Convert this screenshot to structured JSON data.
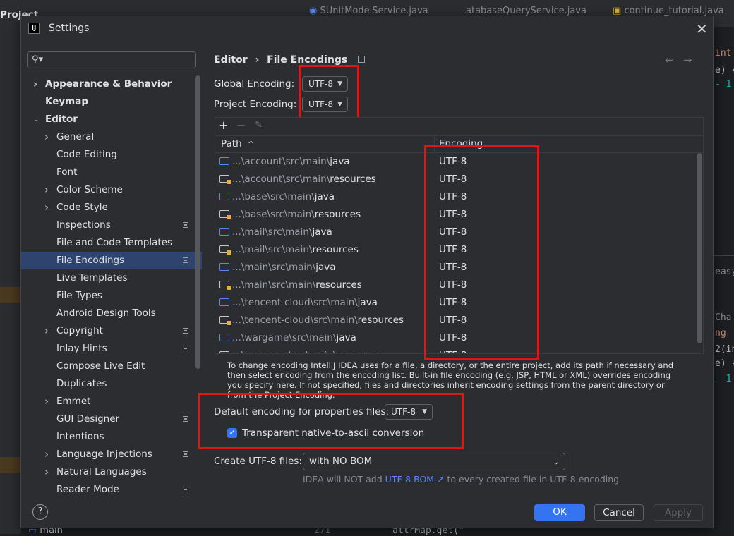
{
  "background": {
    "project_label": "Project",
    "tabs": [
      {
        "label": "SUnitModelService.java"
      },
      {
        "label": "atabaseQueryService.java"
      },
      {
        "label": "continue_tutorial.java"
      }
    ],
    "code_fragments": [
      "int",
      "e) {",
      "- 1",
      "easy",
      "Cha",
      "ng",
      "2(in",
      "e) {",
      "- 1"
    ],
    "bottom_code": "attrMap.get(\"",
    "bottom_line": "271",
    "bottom_node": "main"
  },
  "dialog": {
    "title": "Settings",
    "logo_text": "IJ",
    "search_placeholder": "",
    "tree": [
      {
        "label": "Appearance & Behavior",
        "level": 0,
        "expandable": true,
        "expanded": false,
        "bold": true
      },
      {
        "label": "Keymap",
        "level": 0,
        "expandable": false,
        "bold": true
      },
      {
        "label": "Editor",
        "level": 0,
        "expandable": true,
        "expanded": true,
        "bold": true
      },
      {
        "label": "General",
        "level": 1,
        "expandable": true
      },
      {
        "label": "Code Editing",
        "level": 1
      },
      {
        "label": "Font",
        "level": 1
      },
      {
        "label": "Color Scheme",
        "level": 1,
        "expandable": true
      },
      {
        "label": "Code Style",
        "level": 1,
        "expandable": true
      },
      {
        "label": "Inspections",
        "level": 1,
        "marker": true
      },
      {
        "label": "File and Code Templates",
        "level": 1
      },
      {
        "label": "File Encodings",
        "level": 1,
        "marker": true,
        "selected": true
      },
      {
        "label": "Live Templates",
        "level": 1
      },
      {
        "label": "File Types",
        "level": 1
      },
      {
        "label": "Android Design Tools",
        "level": 1
      },
      {
        "label": "Copyright",
        "level": 1,
        "expandable": true,
        "marker": true
      },
      {
        "label": "Inlay Hints",
        "level": 1,
        "marker": true
      },
      {
        "label": "Compose Live Edit",
        "level": 1
      },
      {
        "label": "Duplicates",
        "level": 1
      },
      {
        "label": "Emmet",
        "level": 1,
        "expandable": true
      },
      {
        "label": "GUI Designer",
        "level": 1,
        "marker": true
      },
      {
        "label": "Intentions",
        "level": 1
      },
      {
        "label": "Language Injections",
        "level": 1,
        "expandable": true,
        "marker": true
      },
      {
        "label": "Natural Languages",
        "level": 1,
        "expandable": true
      },
      {
        "label": "Reader Mode",
        "level": 1,
        "marker": true
      }
    ],
    "breadcrumb": {
      "parent": "Editor",
      "separator": "›",
      "current": "File Encodings"
    },
    "nav": {
      "back": "←",
      "forward": "→"
    },
    "global_encoding": {
      "label": "Global Encoding:",
      "value": "UTF-8"
    },
    "project_encoding": {
      "label": "Project Encoding:",
      "value": "UTF-8"
    },
    "table": {
      "toolbar": {
        "add": "+",
        "remove": "−",
        "edit": "✎"
      },
      "columns": {
        "path": "Path",
        "sort": "^",
        "encoding": "Encoding"
      },
      "rows": [
        {
          "dim": "...\\account\\src\\main\\",
          "name": "java",
          "type": "source",
          "encoding": "UTF-8"
        },
        {
          "dim": "...\\account\\src\\main\\",
          "name": "resources",
          "type": "resources",
          "encoding": "UTF-8"
        },
        {
          "dim": "...\\base\\src\\main\\",
          "name": "java",
          "type": "source",
          "encoding": "UTF-8"
        },
        {
          "dim": "...\\base\\src\\main\\",
          "name": "resources",
          "type": "resources",
          "encoding": "UTF-8"
        },
        {
          "dim": "...\\mail\\src\\main\\",
          "name": "java",
          "type": "source",
          "encoding": "UTF-8"
        },
        {
          "dim": "...\\mail\\src\\main\\",
          "name": "resources",
          "type": "resources",
          "encoding": "UTF-8"
        },
        {
          "dim": "...\\main\\src\\main\\",
          "name": "java",
          "type": "source",
          "encoding": "UTF-8"
        },
        {
          "dim": "...\\main\\src\\main\\",
          "name": "resources",
          "type": "resources",
          "encoding": "UTF-8"
        },
        {
          "dim": "...\\tencent-cloud\\src\\main\\",
          "name": "java",
          "type": "source",
          "encoding": "UTF-8"
        },
        {
          "dim": "...\\tencent-cloud\\src\\main\\",
          "name": "resources",
          "type": "resources",
          "encoding": "UTF-8"
        },
        {
          "dim": "...\\wargame\\src\\main\\",
          "name": "java",
          "type": "source",
          "encoding": "UTF-8"
        },
        {
          "dim": "...\\wargame\\src\\main\\",
          "name": "resources",
          "type": "resources",
          "encoding": "UTF-8"
        }
      ]
    },
    "help_text": "To change encoding IntelliJ IDEA uses for a file, a directory, or the entire project, add its path if necessary and then select encoding from the encoding list. Built-in file encoding (e.g. JSP, HTML or XML) overrides encoding you specify here. If not specified, files and directories inherit encoding settings from the parent directory or from the Project Encoding.",
    "properties": {
      "label": "Default encoding for properties files:",
      "value": "UTF-8"
    },
    "native_to_ascii": {
      "label": "Transparent native-to-ascii conversion",
      "checked": true
    },
    "create_utf8": {
      "label": "Create UTF-8 files:",
      "value": "with NO BOM"
    },
    "bom_hint": {
      "prefix": "IDEA will NOT add",
      "link": "UTF-8 BOM ↗",
      "suffix": "to every created file in UTF-8 encoding"
    },
    "buttons": {
      "help": "?",
      "ok": "OK",
      "cancel": "Cancel",
      "apply": "Apply"
    },
    "colors": {
      "accent": "#3574f0",
      "highlight_box": "#e01515",
      "selection": "#2e436e"
    }
  }
}
